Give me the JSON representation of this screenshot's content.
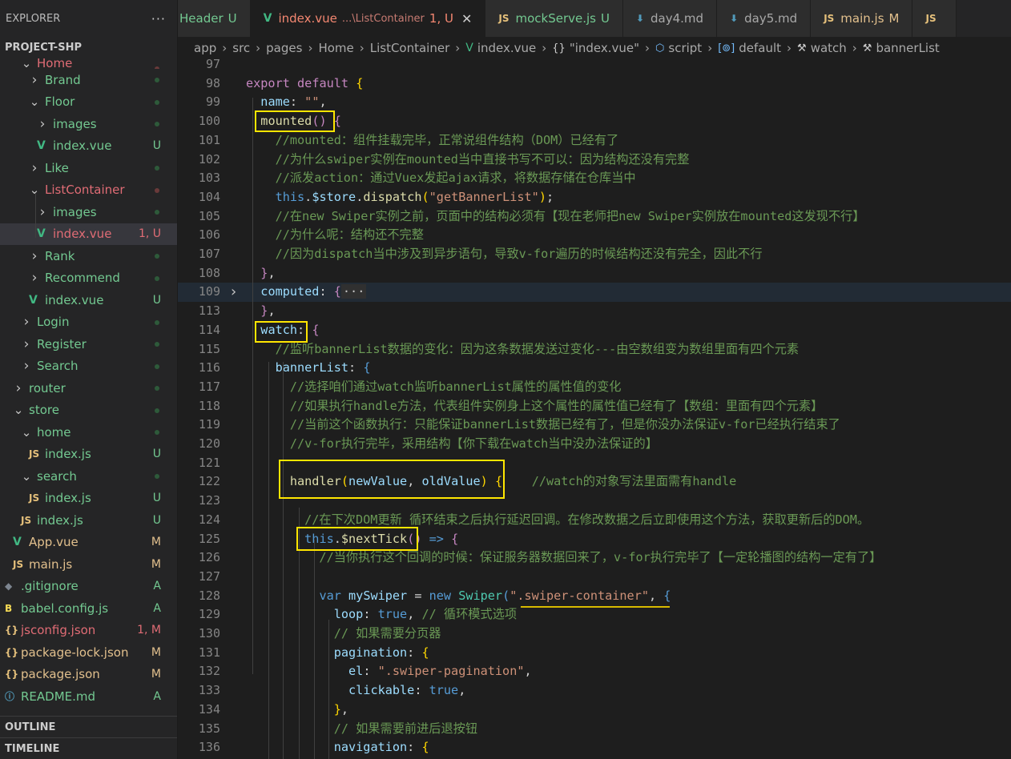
{
  "sidebar": {
    "title": "EXPLORER",
    "more": "···",
    "project": "PROJECT-SHP",
    "items": [
      {
        "name": "Home",
        "depth": 2,
        "type": "folder-open",
        "dot": "red",
        "color": "red",
        "partial": true
      },
      {
        "name": "Brand",
        "depth": 3,
        "type": "folder",
        "dot": "green",
        "color": "green"
      },
      {
        "name": "Floor",
        "depth": 3,
        "type": "folder-open",
        "dot": "green",
        "color": "green"
      },
      {
        "name": "images",
        "depth": 4,
        "type": "folder",
        "dot": "green",
        "color": "green"
      },
      {
        "name": "index.vue",
        "depth": 4,
        "type": "vue",
        "status": "U",
        "color": "green"
      },
      {
        "name": "Like",
        "depth": 3,
        "type": "folder",
        "dot": "green",
        "color": "green"
      },
      {
        "name": "ListContainer",
        "depth": 3,
        "type": "folder-open",
        "dot": "red",
        "color": "red"
      },
      {
        "name": "images",
        "depth": 4,
        "type": "folder",
        "dot": "green",
        "color": "green"
      },
      {
        "name": "index.vue",
        "depth": 4,
        "type": "vue",
        "status": "1, U",
        "color": "red",
        "selected": true
      },
      {
        "name": "Rank",
        "depth": 3,
        "type": "folder",
        "dot": "green",
        "color": "green"
      },
      {
        "name": "Recommend",
        "depth": 3,
        "type": "folder",
        "dot": "green",
        "color": "green"
      },
      {
        "name": "index.vue",
        "depth": 3,
        "type": "vue",
        "status": "U",
        "color": "green"
      },
      {
        "name": "Login",
        "depth": 2,
        "type": "folder",
        "dot": "green",
        "color": "green"
      },
      {
        "name": "Register",
        "depth": 2,
        "type": "folder",
        "dot": "green",
        "color": "green"
      },
      {
        "name": "Search",
        "depth": 2,
        "type": "folder",
        "dot": "green",
        "color": "green"
      },
      {
        "name": "router",
        "depth": 1,
        "type": "folder",
        "dot": "green",
        "color": "green"
      },
      {
        "name": "store",
        "depth": 1,
        "type": "folder-open",
        "dot": "green",
        "color": "green"
      },
      {
        "name": "home",
        "depth": 2,
        "type": "folder-open",
        "dot": "green",
        "color": "green"
      },
      {
        "name": "index.js",
        "depth": 3,
        "type": "js",
        "status": "U",
        "color": "green"
      },
      {
        "name": "search",
        "depth": 2,
        "type": "folder-open",
        "dot": "green",
        "color": "green"
      },
      {
        "name": "index.js",
        "depth": 3,
        "type": "js",
        "status": "U",
        "color": "green"
      },
      {
        "name": "index.js",
        "depth": 2,
        "type": "js",
        "status": "U",
        "color": "green"
      },
      {
        "name": "App.vue",
        "depth": 1,
        "type": "vue",
        "status": "M",
        "color": "yellow"
      },
      {
        "name": "main.js",
        "depth": 1,
        "type": "js",
        "status": "M",
        "color": "yellow"
      },
      {
        "name": ".gitignore",
        "depth": 0,
        "type": "git",
        "status": "A",
        "color": "green"
      },
      {
        "name": "babel.config.js",
        "depth": 0,
        "type": "babel",
        "status": "A",
        "color": "green"
      },
      {
        "name": "jsconfig.json",
        "depth": 0,
        "type": "json",
        "status": "1, M",
        "color": "red"
      },
      {
        "name": "package-lock.json",
        "depth": 0,
        "type": "json",
        "status": "M",
        "color": "yellow"
      },
      {
        "name": "package.json",
        "depth": 0,
        "type": "json",
        "status": "M",
        "color": "yellow"
      },
      {
        "name": "README.md",
        "depth": 0,
        "type": "info",
        "status": "A",
        "color": "green"
      }
    ],
    "outline": "OUTLINE",
    "timeline": "TIMELINE"
  },
  "tabs": [
    {
      "icon": "",
      "label": "Header",
      "status": "U",
      "partial": true
    },
    {
      "icon": "vue",
      "label": "index.vue",
      "desc": "...\\ListContainer",
      "status": "1, U",
      "active": true,
      "close": "✕"
    },
    {
      "icon": "js",
      "label": "mockServe.js",
      "status": "U"
    },
    {
      "icon": "md",
      "label": "day4.md",
      "status": ""
    },
    {
      "icon": "md",
      "label": "day5.md",
      "status": ""
    },
    {
      "icon": "js",
      "label": "main.js",
      "status": "M"
    },
    {
      "icon": "js",
      "label": "",
      "status": ""
    }
  ],
  "breadcrumb": [
    {
      "label": "app"
    },
    {
      "label": "src"
    },
    {
      "label": "pages"
    },
    {
      "label": "Home"
    },
    {
      "label": "ListContainer"
    },
    {
      "label": "index.vue",
      "icon": "vue"
    },
    {
      "label": "\"index.vue\"",
      "icon": "braces"
    },
    {
      "label": "script",
      "icon": "cube"
    },
    {
      "label": "default",
      "icon": "module"
    },
    {
      "label": "watch",
      "icon": "wrench"
    },
    {
      "label": "bannerList",
      "icon": "wrench"
    }
  ],
  "colors": {
    "accent": "#ffe600",
    "vue": "#41b883",
    "js": "#e5c07b",
    "md": "#519aba"
  },
  "code": [
    {
      "n": "97",
      "t": []
    },
    {
      "n": "98",
      "t": [
        [
          "k",
          "export"
        ],
        [
          "pn",
          " "
        ],
        [
          "k",
          "default"
        ],
        [
          "pn",
          " "
        ],
        [
          "br",
          "{"
        ]
      ]
    },
    {
      "n": "99",
      "t": [
        [
          "pn",
          "  "
        ],
        [
          "p",
          "name"
        ],
        [
          "pn",
          ": "
        ],
        [
          "s",
          "\"\""
        ],
        [
          "pn",
          ","
        ]
      ]
    },
    {
      "n": "100",
      "t": [
        [
          "pn",
          "  "
        ],
        [
          "f",
          "mounted"
        ],
        [
          "k",
          "()"
        ],
        [
          "pn",
          " "
        ],
        [
          "k",
          "{"
        ]
      ]
    },
    {
      "n": "101",
      "t": [
        [
          "c",
          "    //mounted：组件挂载完毕，正常说组件结构（DOM）已经有了"
        ]
      ]
    },
    {
      "n": "102",
      "t": [
        [
          "c",
          "    //为什么swiper实例在mounted当中直接书写不可以：因为结构还没有完整"
        ]
      ]
    },
    {
      "n": "103",
      "t": [
        [
          "c",
          "    //派发action：通过Vuex发起ajax请求，将数据存储在仓库当中"
        ]
      ]
    },
    {
      "n": "104",
      "t": [
        [
          "pn",
          "    "
        ],
        [
          "b",
          "this"
        ],
        [
          "pn",
          "."
        ],
        [
          "p",
          "$store"
        ],
        [
          "pn",
          "."
        ],
        [
          "f",
          "dispatch"
        ],
        [
          "br",
          "("
        ],
        [
          "s",
          "\"getBannerList\""
        ],
        [
          "br",
          ")"
        ],
        [
          "pn",
          ";"
        ]
      ]
    },
    {
      "n": "105",
      "t": [
        [
          "c",
          "    //在new Swiper实例之前，页面中的结构必须有【现在老师把new Swiper实例放在mounted这发现不行】"
        ]
      ]
    },
    {
      "n": "106",
      "t": [
        [
          "c",
          "    //为什么呢：结构还不完整"
        ]
      ]
    },
    {
      "n": "107",
      "t": [
        [
          "c",
          "    //因为dispatch当中涉及到异步语句，导致v-for遍历的时候结构还没有完全，因此不行"
        ]
      ]
    },
    {
      "n": "108",
      "t": [
        [
          "pn",
          "  "
        ],
        [
          "k",
          "}"
        ],
        [
          "pn",
          ","
        ]
      ]
    },
    {
      "n": "109",
      "t": [
        [
          "pn",
          "  "
        ],
        [
          "p",
          "computed"
        ],
        [
          "pn",
          ": "
        ],
        [
          "k",
          "{"
        ],
        [
          "fd",
          "···"
        ]
      ],
      "fold": "›",
      "current": true
    },
    {
      "n": "113",
      "t": [
        [
          "pn",
          "  "
        ],
        [
          "k",
          "}"
        ],
        [
          "pn",
          ","
        ]
      ]
    },
    {
      "n": "114",
      "t": [
        [
          "pn",
          "  "
        ],
        [
          "p",
          "watch"
        ],
        [
          "pn",
          ": "
        ],
        [
          "k",
          "{"
        ]
      ]
    },
    {
      "n": "115",
      "t": [
        [
          "c",
          "    //监听bannerList数据的变化：因为这条数据发送过变化---由空数组变为数组里面有四个元素"
        ]
      ]
    },
    {
      "n": "116",
      "t": [
        [
          "pn",
          "    "
        ],
        [
          "p",
          "bannerList"
        ],
        [
          "pn",
          ": "
        ],
        [
          "b",
          "{"
        ]
      ]
    },
    {
      "n": "117",
      "t": [
        [
          "c",
          "      //选择咱们通过watch监听bannerList属性的属性值的变化"
        ]
      ]
    },
    {
      "n": "118",
      "t": [
        [
          "c",
          "      //如果执行handle方法，代表组件实例身上这个属性的属性值已经有了【数组：里面有四个元素】"
        ]
      ]
    },
    {
      "n": "119",
      "t": [
        [
          "c",
          "      //当前这个函数执行：只能保证bannerList数据已经有了，但是你没办法保证v-for已经执行结束了"
        ]
      ]
    },
    {
      "n": "120",
      "t": [
        [
          "c",
          "      //v-for执行完毕，采用结构【你下载在watch当中没办法保证的】"
        ]
      ]
    },
    {
      "n": "121",
      "t": []
    },
    {
      "n": "122",
      "t": [
        [
          "pn",
          "      "
        ],
        [
          "f",
          "handler"
        ],
        [
          "br",
          "("
        ],
        [
          "p",
          "newValue"
        ],
        [
          "pn",
          ", "
        ],
        [
          "p",
          "oldValue"
        ],
        [
          "br",
          ")"
        ],
        [
          "pn",
          " "
        ],
        [
          "br",
          "{"
        ],
        [
          "pn",
          "    "
        ],
        [
          "c",
          "//watch的对象写法里面需有handle"
        ]
      ]
    },
    {
      "n": "123",
      "t": []
    },
    {
      "n": "124",
      "t": [
        [
          "c",
          "        //在下次DOM更新 循环结束之后执行延迟回调。在修改数据之后立即使用这个方法，获取更新后的DOM。"
        ]
      ]
    },
    {
      "n": "125",
      "t": [
        [
          "pn",
          "        "
        ],
        [
          "b",
          "this"
        ],
        [
          "pn",
          "."
        ],
        [
          "f",
          "$nextTick"
        ],
        [
          "k",
          "("
        ],
        [
          "k",
          ")"
        ],
        [
          "pn",
          " "
        ],
        [
          "b",
          "=>"
        ],
        [
          "pn",
          " "
        ],
        [
          "k",
          "{"
        ]
      ]
    },
    {
      "n": "126",
      "t": [
        [
          "c",
          "          //当你执行这个回调的时候：保证服务器数据回来了，v-for执行完毕了【一定轮播图的结构一定有了】"
        ]
      ]
    },
    {
      "n": "127",
      "t": []
    },
    {
      "n": "128",
      "t": [
        [
          "pn",
          "          "
        ],
        [
          "b",
          "var"
        ],
        [
          "pn",
          " "
        ],
        [
          "p",
          "mySwiper"
        ],
        [
          "pn",
          " = "
        ],
        [
          "b",
          "new"
        ],
        [
          "pn",
          " "
        ],
        [
          "cl",
          "Swiper"
        ],
        [
          "b",
          "("
        ],
        [
          "s",
          "\".swiper-container\""
        ],
        [
          "pn",
          ", "
        ],
        [
          "b",
          "{"
        ]
      ]
    },
    {
      "n": "129",
      "t": [
        [
          "pn",
          "            "
        ],
        [
          "p",
          "loop"
        ],
        [
          "pn",
          ": "
        ],
        [
          "b",
          "true"
        ],
        [
          "pn",
          ", "
        ],
        [
          "c",
          "// 循环模式选项"
        ]
      ]
    },
    {
      "n": "130",
      "t": [
        [
          "pn",
          "            "
        ],
        [
          "c",
          "// 如果需要分页器"
        ]
      ]
    },
    {
      "n": "131",
      "t": [
        [
          "pn",
          "            "
        ],
        [
          "p",
          "pagination"
        ],
        [
          "pn",
          ": "
        ],
        [
          "br",
          "{"
        ]
      ]
    },
    {
      "n": "132",
      "t": [
        [
          "pn",
          "              "
        ],
        [
          "p",
          "el"
        ],
        [
          "pn",
          ": "
        ],
        [
          "s",
          "\".swiper-pagination\""
        ],
        [
          "pn",
          ","
        ]
      ]
    },
    {
      "n": "133",
      "t": [
        [
          "pn",
          "              "
        ],
        [
          "p",
          "clickable"
        ],
        [
          "pn",
          ": "
        ],
        [
          "b",
          "true"
        ],
        [
          "pn",
          ","
        ]
      ]
    },
    {
      "n": "134",
      "t": [
        [
          "pn",
          "            "
        ],
        [
          "br",
          "}"
        ],
        [
          "pn",
          ","
        ]
      ]
    },
    {
      "n": "135",
      "t": [
        [
          "pn",
          "            "
        ],
        [
          "c",
          "// 如果需要前进后退按钮"
        ]
      ]
    },
    {
      "n": "136",
      "t": [
        [
          "pn",
          "            "
        ],
        [
          "p",
          "navigation"
        ],
        [
          "pn",
          ": "
        ],
        [
          "br",
          "{"
        ]
      ]
    }
  ]
}
